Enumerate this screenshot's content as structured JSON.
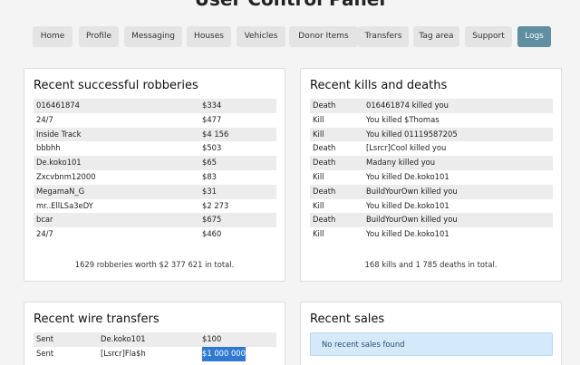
{
  "page": {
    "title": "User Control Panel"
  },
  "nav": [
    {
      "label": "Home",
      "active": false
    },
    {
      "label": "Profile",
      "active": false
    },
    {
      "label": "Messaging",
      "active": false
    },
    {
      "label": "Houses",
      "active": false
    },
    {
      "label": "Vehicles",
      "active": false
    },
    {
      "label": "Donor Items",
      "active": false
    },
    {
      "label": "Transfers",
      "active": false
    },
    {
      "label": "Tag area",
      "active": false
    },
    {
      "label": "Support",
      "active": false
    },
    {
      "label": "Logs",
      "active": true
    }
  ],
  "robberies": {
    "title": "Recent successful robberies",
    "rows": [
      {
        "place": "016461874",
        "amount": "$334"
      },
      {
        "place": "24/7",
        "amount": "$477"
      },
      {
        "place": "Inside Track",
        "amount": "$4 156"
      },
      {
        "place": "bbbhh",
        "amount": "$503"
      },
      {
        "place": "De.koko101",
        "amount": "$65"
      },
      {
        "place": "Zxcvbnm12000",
        "amount": "$83"
      },
      {
        "place": "MegamaN_G",
        "amount": "$31"
      },
      {
        "place": "mr..EllLSa3eDY",
        "amount": "$2 273"
      },
      {
        "place": "bcar",
        "amount": "$675"
      },
      {
        "place": "24/7",
        "amount": "$460"
      }
    ],
    "summary": "1629 robberies worth $2 377 621 in total."
  },
  "kills": {
    "title": "Recent kills and deaths",
    "rows": [
      {
        "type": "Death",
        "desc": "016461874 killed you"
      },
      {
        "type": "Kill",
        "desc": "You killed $Thomas"
      },
      {
        "type": "Kill",
        "desc": "You killed 01119587205"
      },
      {
        "type": "Death",
        "desc": "[Lsrcr]Cool killed you"
      },
      {
        "type": "Death",
        "desc": "Madany killed you"
      },
      {
        "type": "Kill",
        "desc": "You killed De.koko101"
      },
      {
        "type": "Death",
        "desc": "BuildYourOwn killed you"
      },
      {
        "type": "Kill",
        "desc": "You killed De.koko101"
      },
      {
        "type": "Death",
        "desc": "BuildYourOwn killed you"
      },
      {
        "type": "Kill",
        "desc": "You killed De.koko101"
      }
    ],
    "summary": "168 kills and 1 785 deaths in total."
  },
  "transfers": {
    "title": "Recent wire transfers",
    "rows": [
      {
        "dir": "Sent",
        "who": "De.koko101",
        "amount": "$100"
      },
      {
        "dir": "Sent",
        "who": "[Lsrcr]Fla$h",
        "amount": "$1 000 000"
      }
    ]
  },
  "sales": {
    "title": "Recent sales",
    "empty": "No recent sales found"
  }
}
